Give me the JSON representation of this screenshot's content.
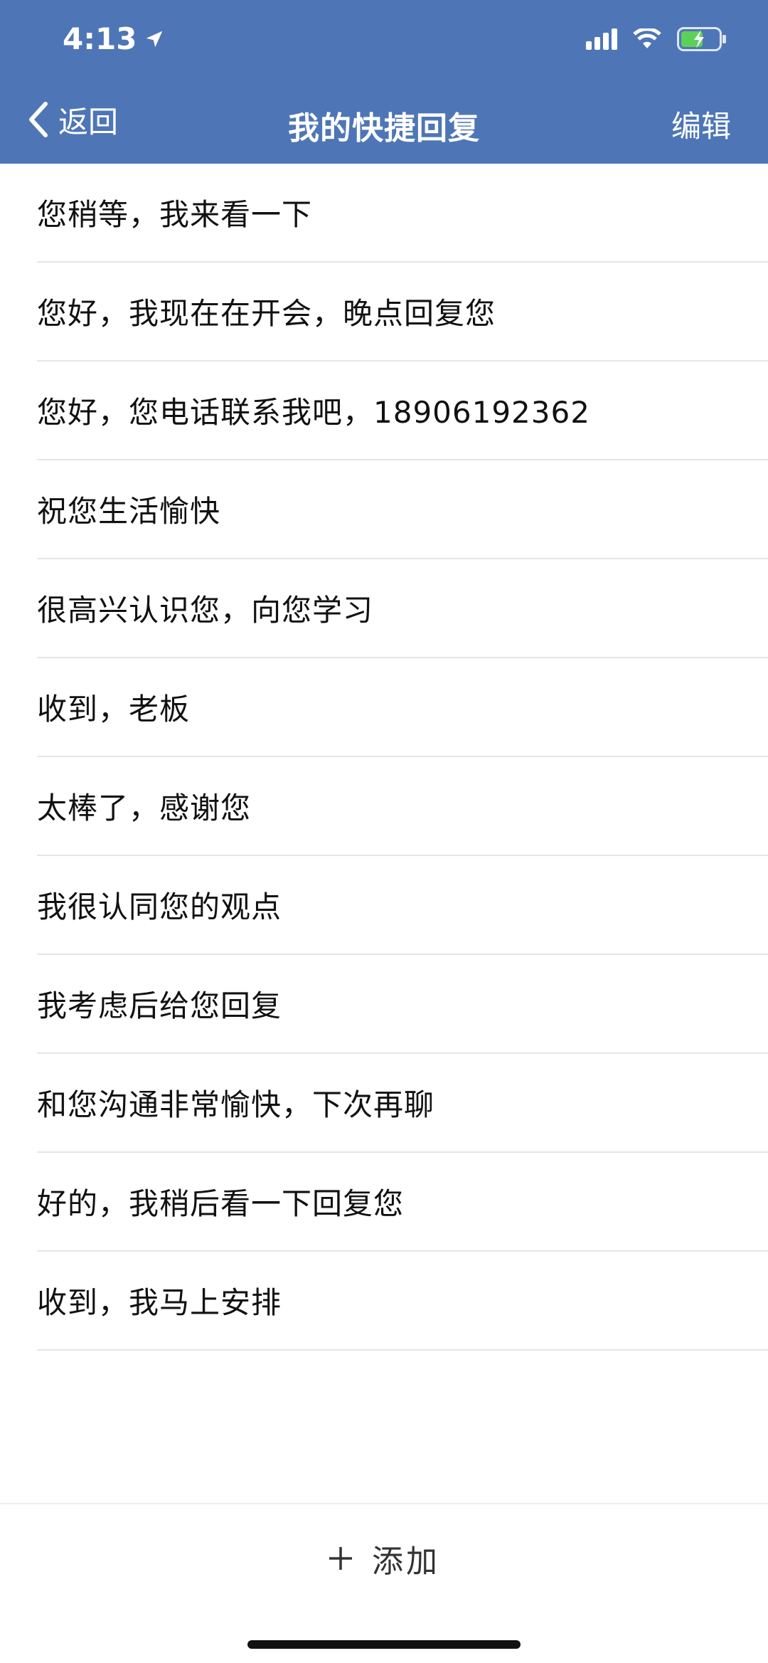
{
  "status_bar": {
    "time": "4:13"
  },
  "nav": {
    "back_label": "返回",
    "title": "我的快捷回复",
    "edit_label": "编辑"
  },
  "replies": [
    "您稍等，我来看一下",
    "您好，我现在在开会，晚点回复您",
    "您好，您电话联系我吧，18906192362",
    "祝您生活愉快",
    "很高兴认识您，向您学习",
    "收到，老板",
    "太棒了，感谢您",
    "我很认同您的观点",
    "我考虑后给您回复",
    "和您沟通非常愉快，下次再聊",
    "好的，我稍后看一下回复您",
    "收到，我马上安排"
  ],
  "footer": {
    "add_label": "添加"
  },
  "colors": {
    "header": "#4e76b6",
    "battery_charging": "#5dd05a"
  },
  "icons": {
    "back": "chevron-left-icon",
    "add": "plus-icon",
    "location": "location-arrow-icon"
  }
}
